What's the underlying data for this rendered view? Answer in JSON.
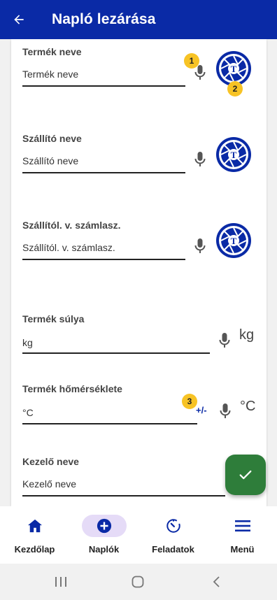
{
  "appbar": {
    "title": "Napló lezárása",
    "back_icon": "arrow-left-icon"
  },
  "fields": {
    "product_name": {
      "label": "Termék neve",
      "placeholder": "Termék neve"
    },
    "supplier_name": {
      "label": "Szállító neve",
      "placeholder": "Szállító neve"
    },
    "invoice_number": {
      "label": "Szállítól. v. számlasz.",
      "placeholder": "Szállítól. v. számlasz."
    },
    "weight": {
      "label": "Termék súlya",
      "placeholder": "kg",
      "unit": "kg"
    },
    "temperature": {
      "label": "Termék hőmérséklete",
      "placeholder": "°C",
      "unit": "°C",
      "plusminus": "+/-"
    },
    "operator": {
      "label": "Kezelő neve",
      "placeholder": "Kezelő neve"
    }
  },
  "badges": {
    "one": "1",
    "two": "2",
    "three": "3"
  },
  "fab": {
    "icon": "check-icon"
  },
  "bottom_nav": [
    {
      "label": "Kezdőlap",
      "icon": "home-icon"
    },
    {
      "label": "Naplók",
      "icon": "add-circle-icon",
      "active": true
    },
    {
      "label": "Feladatok",
      "icon": "timer-icon"
    },
    {
      "label": "Menü",
      "icon": "menu-icon"
    }
  ],
  "colors": {
    "primary": "#0a2aa6",
    "accent": "#2e7d3a",
    "badge": "#f7c325",
    "active_nav": "#e5dbf7"
  }
}
